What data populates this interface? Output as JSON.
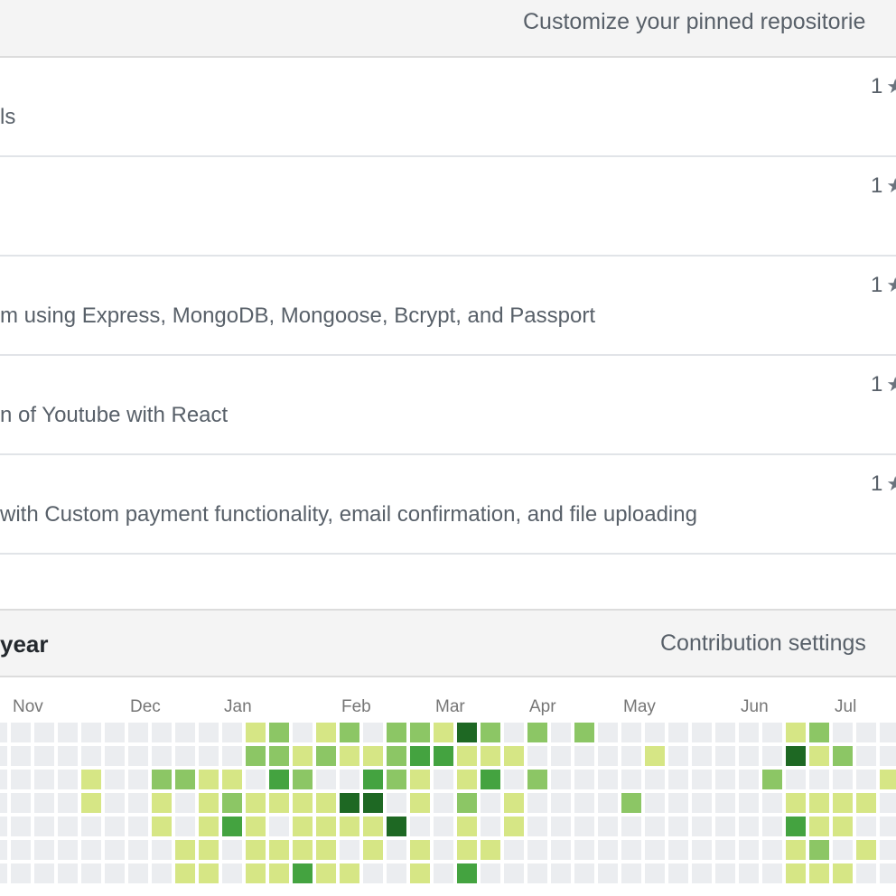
{
  "pinned": {
    "title": "Customize your pinned repositorie",
    "repos": [
      {
        "description": "ls",
        "stars": "1"
      },
      {
        "description": "",
        "stars": "1"
      },
      {
        "description": "m using Express, MongoDB, Mongoose, Bcrypt, and Passport",
        "stars": "1"
      },
      {
        "description": "n of Youtube with React",
        "stars": "1"
      },
      {
        "description": "with Custom payment functionality, email confirmation, and file uploading",
        "stars": "1"
      }
    ]
  },
  "contributions": {
    "title": "year",
    "settings_label": "Contribution settings",
    "months": [
      "Nov",
      "Dec",
      "Jan",
      "Feb",
      "Mar",
      "Apr",
      "May",
      "Jun",
      "Jul"
    ],
    "colors": [
      "#ebedf0",
      "#d6e685",
      "#8cc665",
      "#44a340",
      "#1e6823"
    ],
    "levels": [
      "00000000000120120221420202000000001200000",
      "00000000000221211233111000001000004120011",
      "00001002211032003210130200000000020000110",
      "00001001012111144010201000020000001111010",
      "00000001013101111400101000000000003110010",
      "00000000110111101010110000000000001201010",
      "00000000110113110010300000000000001110000"
    ]
  }
}
